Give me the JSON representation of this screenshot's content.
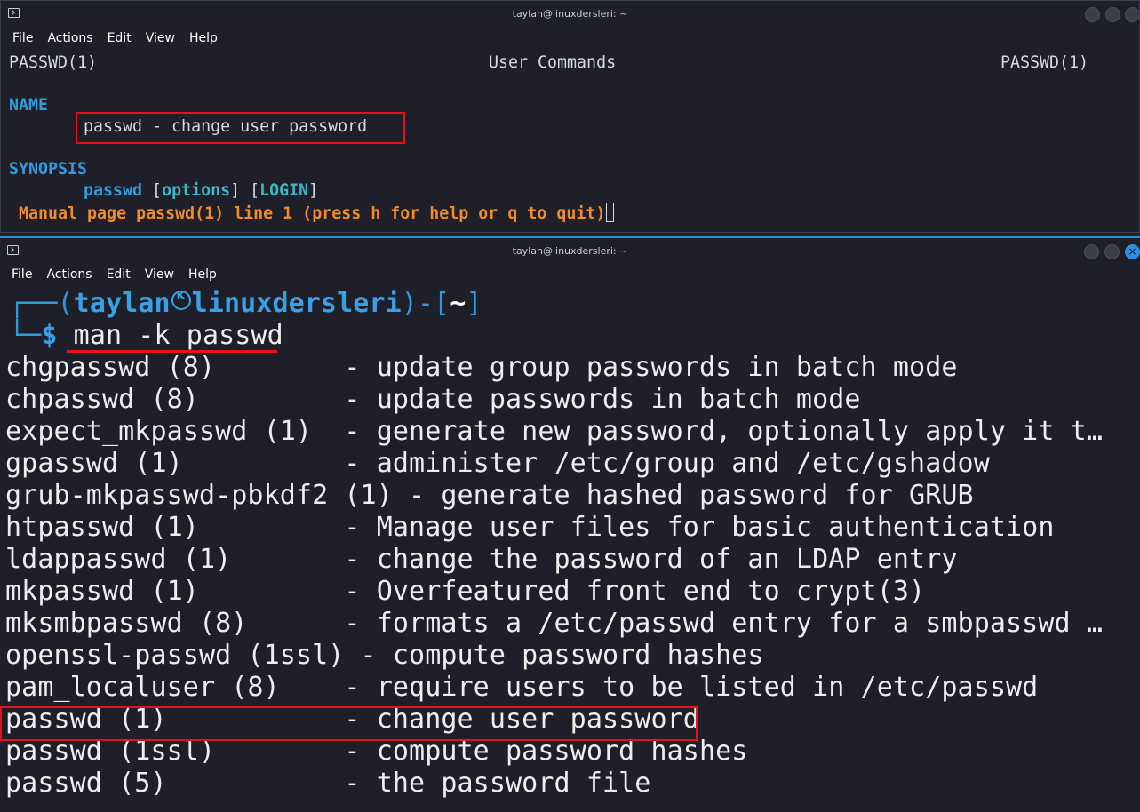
{
  "window_top": {
    "title": "taylan@linuxdersleri: ~",
    "menu": [
      "File",
      "Actions",
      "Edit",
      "View",
      "Help"
    ],
    "header_left": "PASSWD(1)",
    "header_center": "User Commands",
    "header_right": "PASSWD(1)",
    "name_heading": "NAME",
    "name_text": "passwd - change user password",
    "synopsis_heading": "SYNOPSIS",
    "synopsis_cmd": "passwd",
    "synopsis_open1": " [",
    "synopsis_opt": "options",
    "synopsis_mid": "] [",
    "synopsis_login": "LOGIN",
    "synopsis_close": "]",
    "status": " Manual page passwd(1) line 1 (press h for help or q to quit)"
  },
  "window_bottom": {
    "title": "taylan@linuxdersleri: ~",
    "menu": [
      "File",
      "Actions",
      "Edit",
      "View",
      "Help"
    ],
    "prompt_user": "taylan",
    "prompt_host": "linuxdersleri",
    "prompt_dir": "~",
    "command": "man -k passwd",
    "results": [
      "chgpasswd (8)        - update group passwords in batch mode",
      "chpasswd (8)         - update passwords in batch mode",
      "expect_mkpasswd (1)  - generate new password, optionally apply it t…",
      "gpasswd (1)          - administer /etc/group and /etc/gshadow",
      "grub-mkpasswd-pbkdf2 (1) - generate hashed password for GRUB",
      "htpasswd (1)         - Manage user files for basic authentication",
      "ldappasswd (1)       - change the password of an LDAP entry",
      "mkpasswd (1)         - Overfeatured front end to crypt(3)",
      "mksmbpasswd (8)      - formats a /etc/passwd entry for a smbpasswd …",
      "openssl-passwd (1ssl) - compute password hashes",
      "pam_localuser (8)    - require users to be listed in /etc/passwd",
      "passwd (1)           - change user password",
      "passwd (1ssl)        - compute password hashes",
      "passwd (5)           - the password file"
    ]
  }
}
